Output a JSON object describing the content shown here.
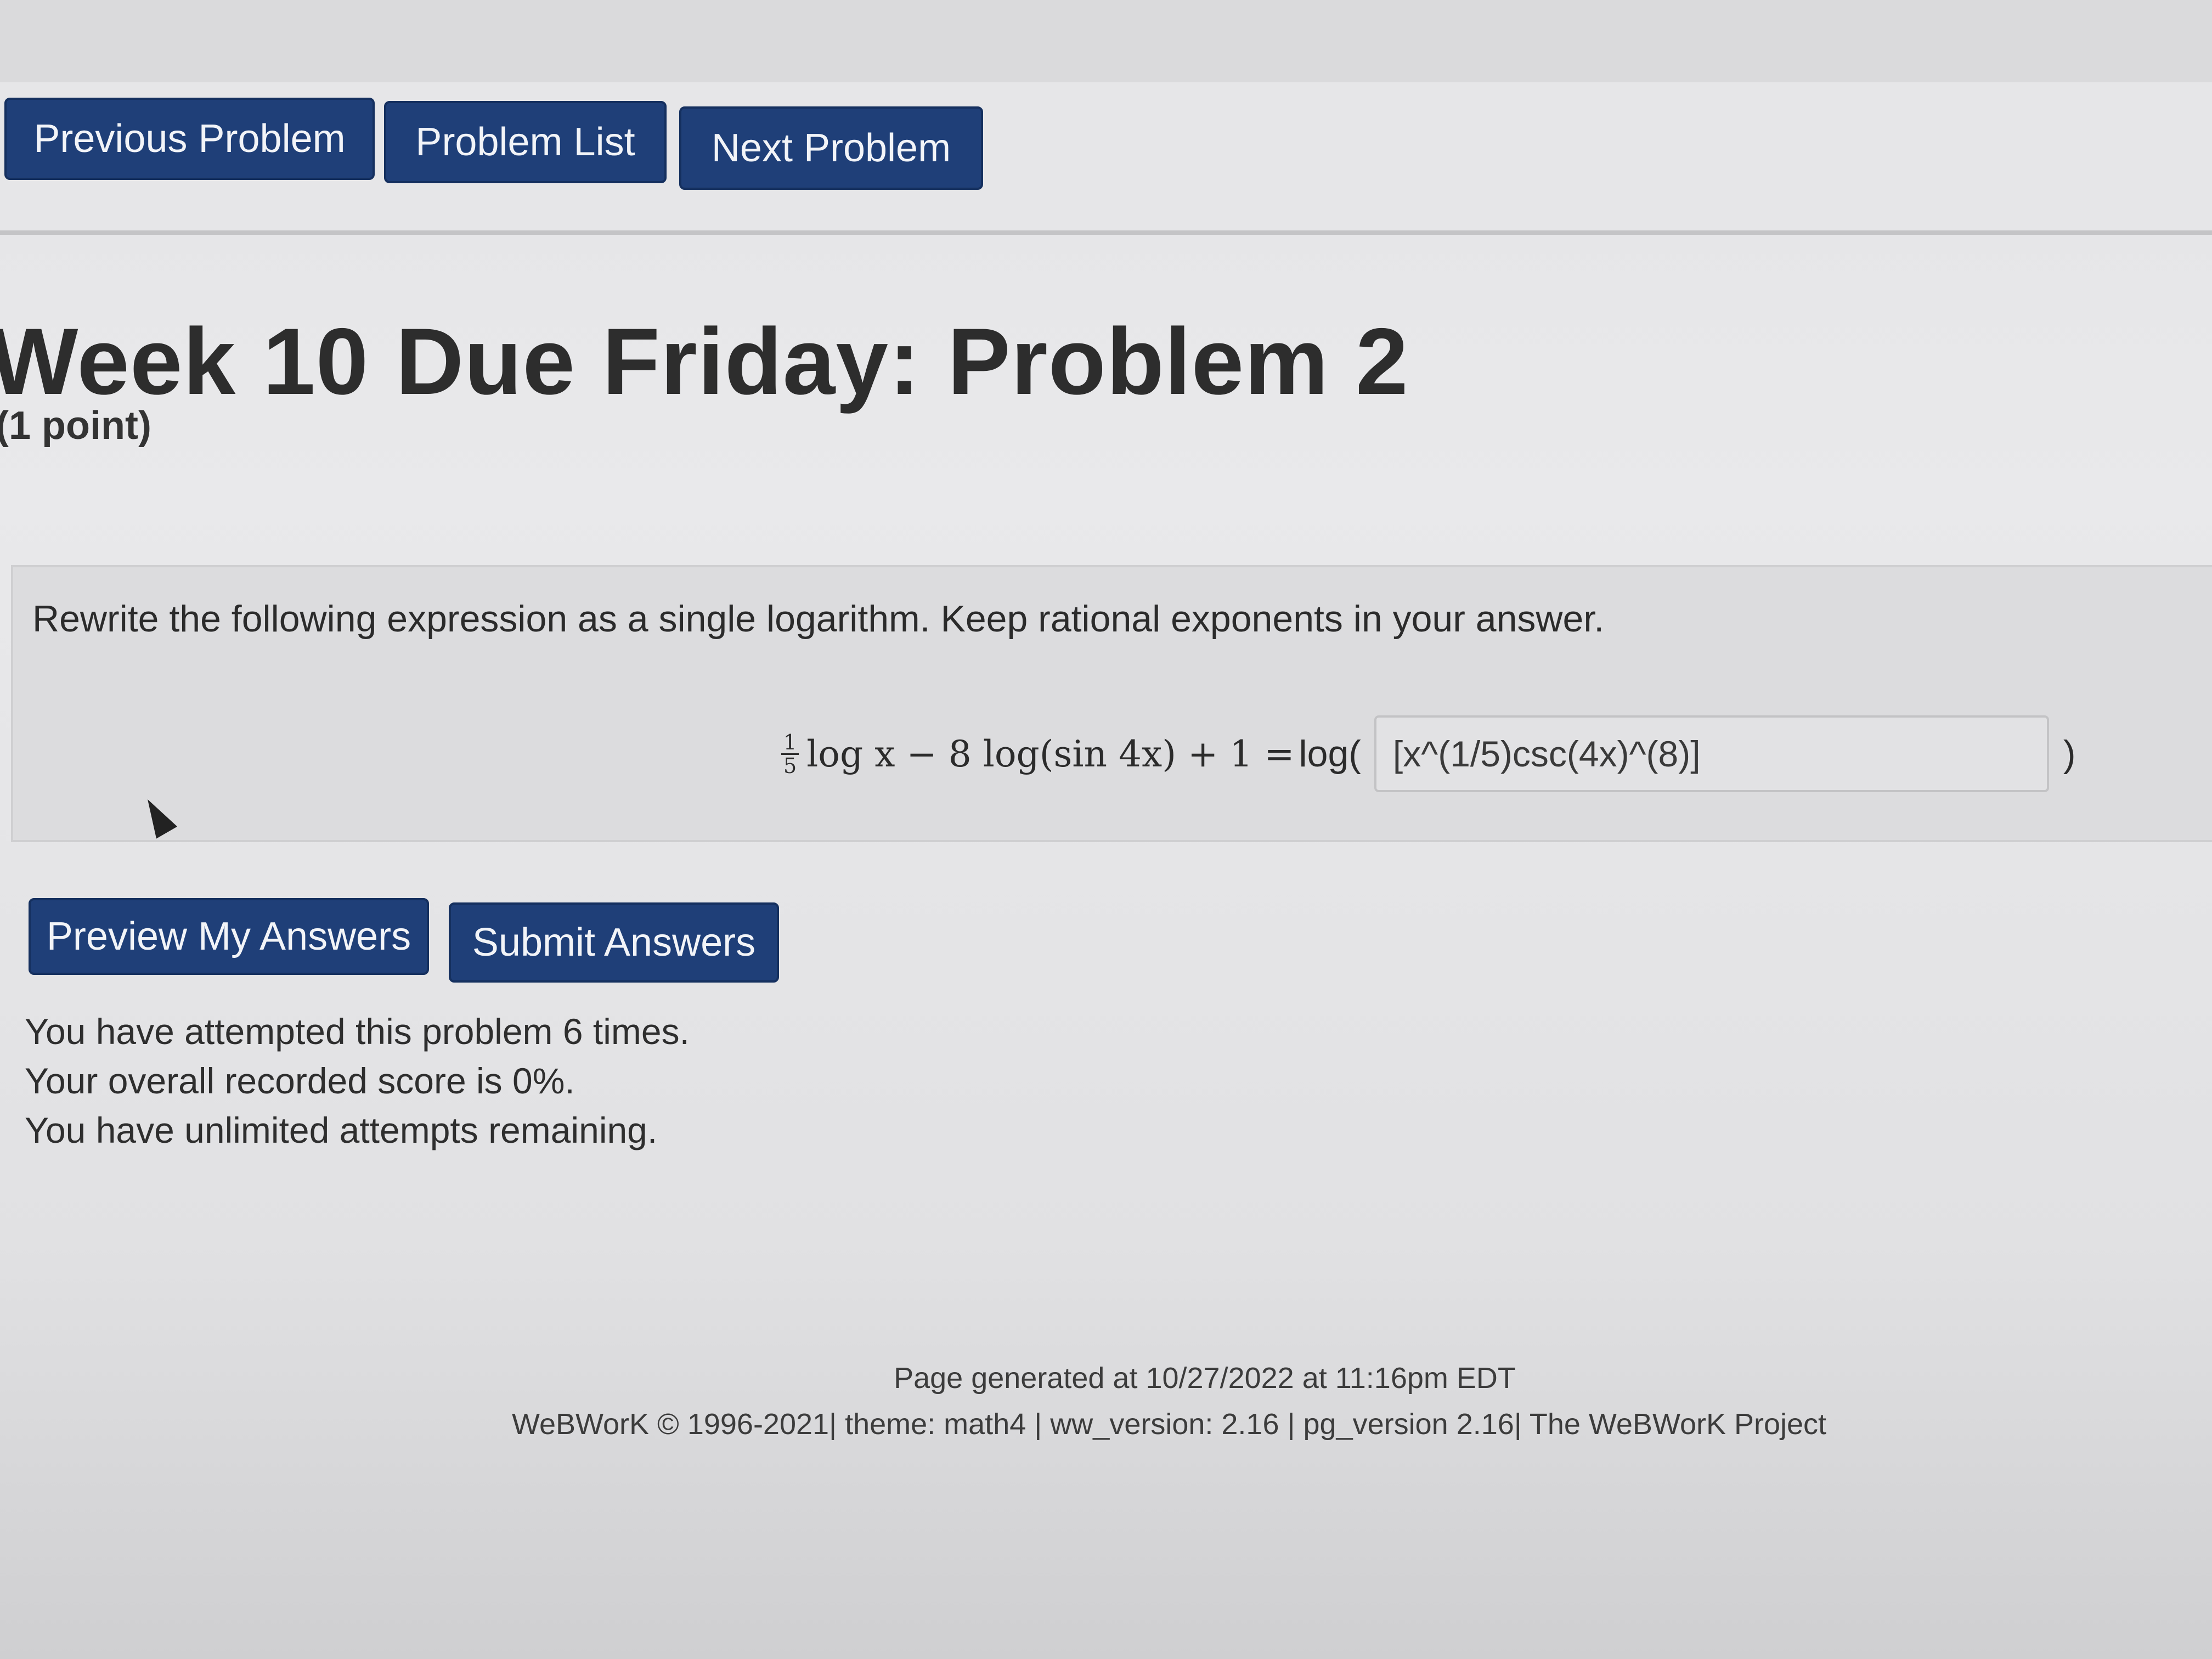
{
  "nav": {
    "previous_label": "Previous Problem",
    "list_label": "Problem List",
    "next_label": "Next Problem"
  },
  "problem": {
    "title": "Week 10 Due Friday: Problem 2",
    "points": "(1 point)",
    "instructions": "Rewrite the following expression as a single logarithm. Keep rational exponents in your answer.",
    "equation": {
      "frac_num": "1",
      "frac_den": "5",
      "expression": "log x − 8 log(sin 4x) + 1 = ",
      "log_prefix": "log(",
      "close_paren": ")"
    },
    "answer_value": "[x^(1/5)csc(4x)^(8)]"
  },
  "actions": {
    "preview_label": "Preview My Answers",
    "submit_label": "Submit Answers"
  },
  "status": {
    "attempts": "You have attempted this problem 6 times.",
    "score": "Your overall recorded score is 0%.",
    "remaining": "You have unlimited attempts remaining."
  },
  "footer": {
    "generated": "Page generated at 10/27/2022 at 11:16pm EDT",
    "credits": "WeBWorK © 1996-2021| theme: math4 | ww_version: 2.16 | pg_version 2.16| The WeBWorK Project"
  },
  "colors": {
    "button_bg": "#1f3f78",
    "page_bg": "#e6e6e8"
  },
  "icons": {
    "cursor": "mouse-pointer-icon"
  }
}
